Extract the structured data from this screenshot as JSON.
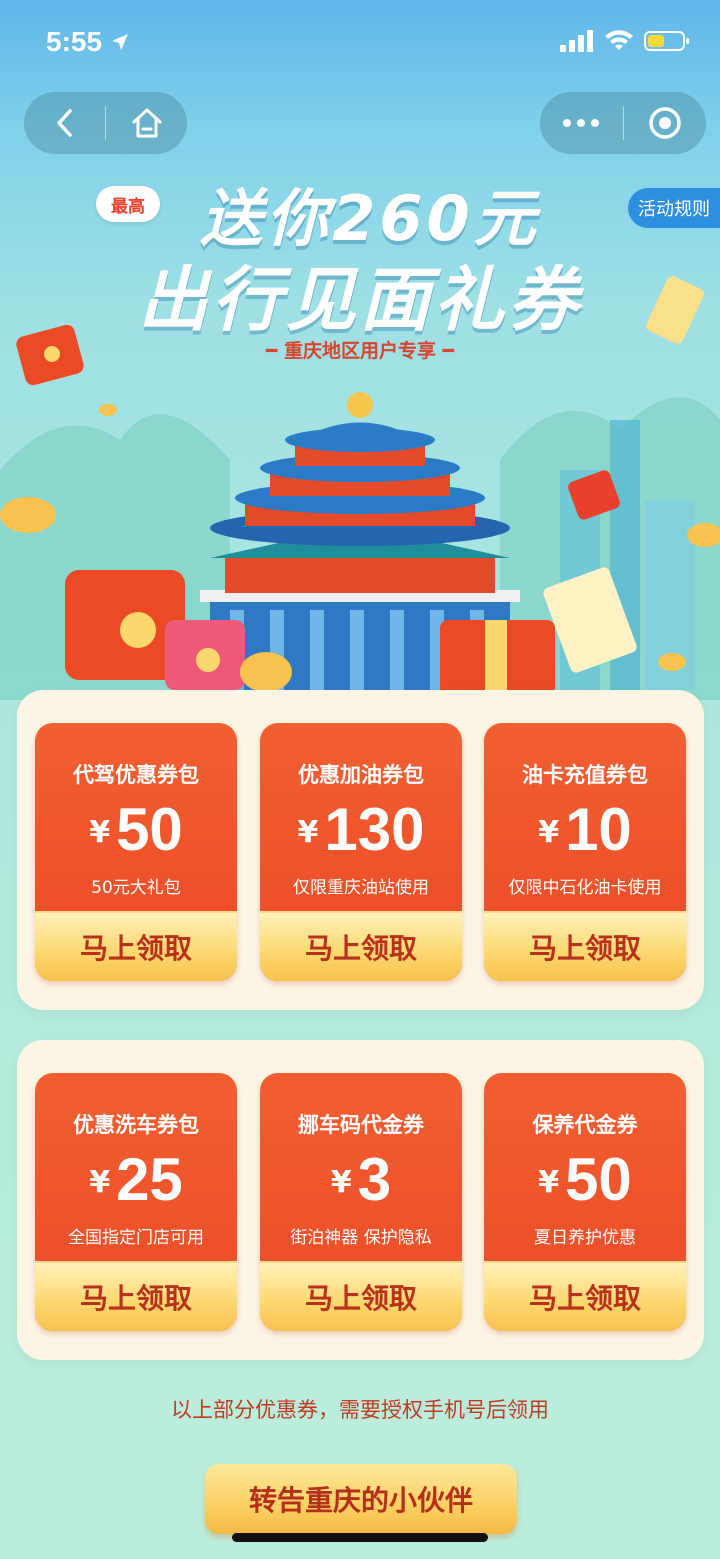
{
  "status_bar": {
    "time": "5:55"
  },
  "nav": {
    "back_icon": "chevron-left-icon",
    "home_icon": "home-icon",
    "more_icon": "more-dots-icon",
    "close_icon": "target-close-icon"
  },
  "rules_tab": "活动规则",
  "hero": {
    "badge": "最高",
    "headline_line1": "送你260元",
    "headline_line2": "出行见面礼券",
    "subhead": "━ 重庆地区用户专享 ━"
  },
  "coupons_group1": [
    {
      "title": "代驾优惠券包",
      "currency": "¥",
      "amount": "50",
      "desc": "50元大礼包",
      "button": "马上领取"
    },
    {
      "title": "优惠加油券包",
      "currency": "¥",
      "amount": "130",
      "desc": "仅限重庆油站使用",
      "button": "马上领取"
    },
    {
      "title": "油卡充值券包",
      "currency": "¥",
      "amount": "10",
      "desc": "仅限中石化油卡使用",
      "button": "马上领取"
    }
  ],
  "coupons_group2": [
    {
      "title": "优惠洗车券包",
      "currency": "¥",
      "amount": "25",
      "desc": "全国指定门店可用",
      "button": "马上领取"
    },
    {
      "title": "挪车码代金券",
      "currency": "¥",
      "amount": "3",
      "desc": "街泊神器 保护隐私",
      "button": "马上领取"
    },
    {
      "title": "保养代金券",
      "currency": "¥",
      "amount": "50",
      "desc": "夏日养护优惠",
      "button": "马上领取"
    }
  ],
  "note": "以上部分优惠券，需要授权手机号后领用",
  "share_button": "转告重庆的小伙伴",
  "colors": {
    "accent": "#ec4a25",
    "gold": "#fcd76e",
    "sky": "#5fb6ea"
  }
}
